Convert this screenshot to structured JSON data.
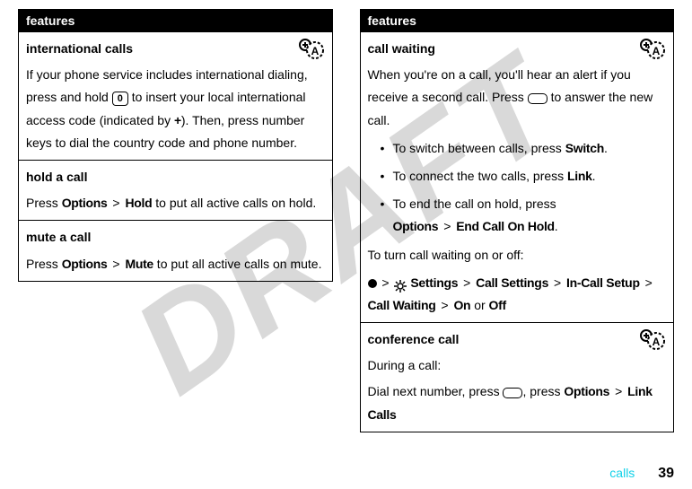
{
  "watermark": "DRAFT",
  "left": {
    "header": "features",
    "items": [
      {
        "title": "international calls",
        "hasBadge": true,
        "body_a": "If your phone service includes international dialing, press and hold ",
        "key": "0",
        "body_b": " to insert your local international access code (indicated by ",
        "plus": "+",
        "body_c": "). Then, press number keys to dial the country code and phone number."
      },
      {
        "title": "hold a call",
        "hasBadge": false,
        "body_a": "Press ",
        "opt": "Options",
        "gt": ">",
        "act": "Hold",
        "body_b": " to put all active calls on hold."
      },
      {
        "title": "mute a call",
        "hasBadge": false,
        "body_a": "Press ",
        "opt": "Options",
        "gt": ">",
        "act": "Mute",
        "body_b": " to put all active calls on mute."
      }
    ]
  },
  "right": {
    "header": "features",
    "callwaiting": {
      "title": "call waiting",
      "p1a": "When you're on a call, you'll hear an alert if you receive a second call. Press ",
      "p1b": " to answer the new call.",
      "b1a": "To switch between calls, press ",
      "b1b": "Switch",
      "b1c": ".",
      "b2a": "To connect the two calls, press ",
      "b2b": "Link",
      "b2c": ".",
      "b3a": "To end the call on hold, press ",
      "b3b": "Options",
      "b3gt": ">",
      "b3c": "End Call On Hold",
      "b3d": ".",
      "p2": "To turn call waiting on or off:",
      "nav": {
        "gt": ">",
        "settings": "Settings",
        "callsettings": "Call Settings",
        "incall": "In-Call Setup",
        "cw": "Call Waiting",
        "on": "On",
        "or": " or ",
        "off": "Off"
      }
    },
    "conf": {
      "title": "conference call",
      "p1": "During a call:",
      "p2a": "Dial next number, press ",
      "p2b": ", press ",
      "opt": "Options",
      "gt": ">",
      "act": "Link Calls"
    }
  },
  "footer": {
    "section": "calls",
    "page": "39"
  }
}
